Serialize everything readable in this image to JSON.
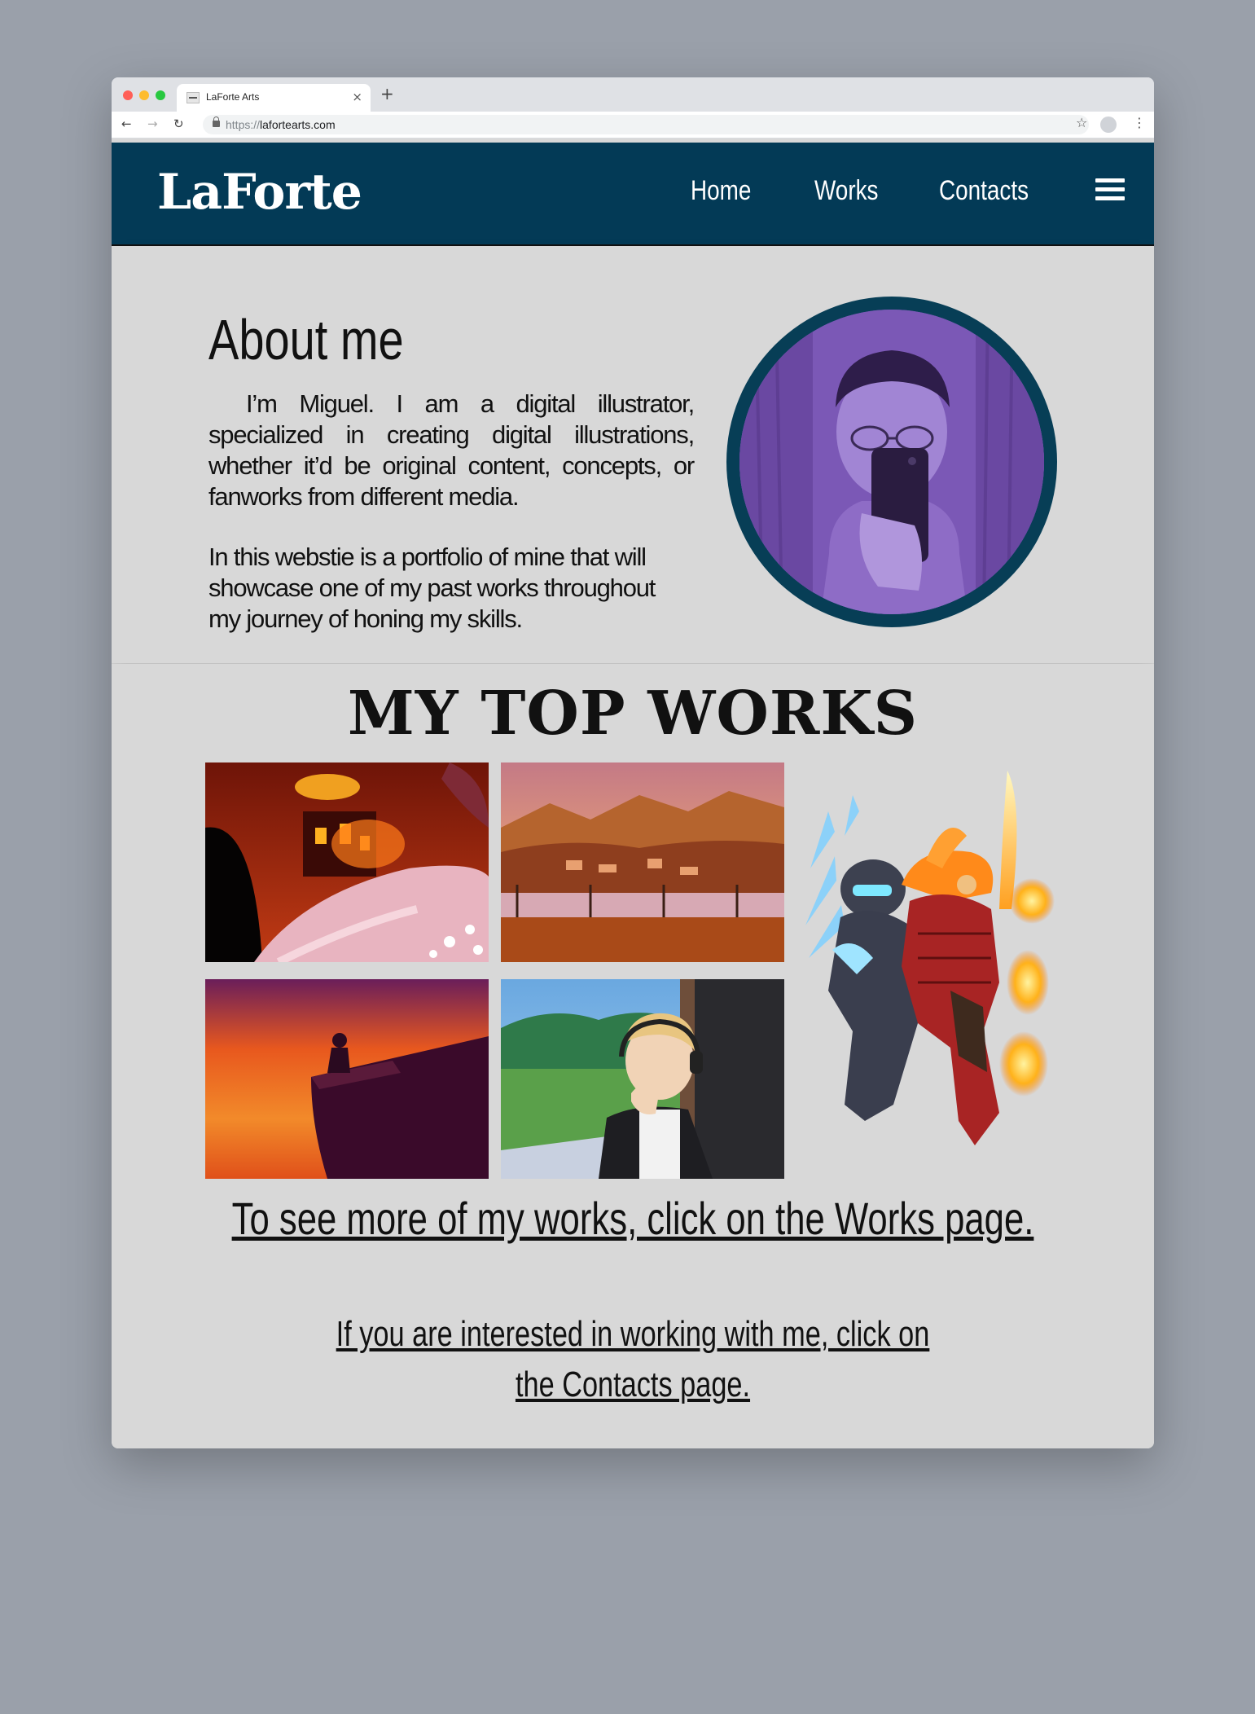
{
  "browser": {
    "tab_title": "LaForte Arts",
    "tab_close": "×",
    "new_tab": "+",
    "url_scheme": "https://",
    "url_host": "lafortearts.com",
    "back": "←",
    "forward": "→",
    "reload": "↻",
    "star": "☆",
    "menu": "⋮"
  },
  "site": {
    "logo": "LaForte",
    "nav": [
      "Home",
      "Works",
      "Contacts"
    ],
    "colors": {
      "header": "#033a56",
      "background": "#d8d8d8",
      "avatar_ring": "#073e56"
    }
  },
  "about": {
    "heading": "About me",
    "paragraph1": "I’m Miguel. I am a digital illustrator, specialized in creating digital illustrations, whether it’d be original content, concepts, or fanworks from different media.",
    "paragraph2": "In this webstie is a portfolio of mine that will showcase one of my past works throughout my journey of honing my skills."
  },
  "works": {
    "heading": "MY TOP WORKS",
    "cta_works": "To see more of my works, click on the Works page.",
    "cta_contacts_line1": "If you are interested in working with me, click on",
    "cta_contacts_line2": "the Contacts page."
  }
}
